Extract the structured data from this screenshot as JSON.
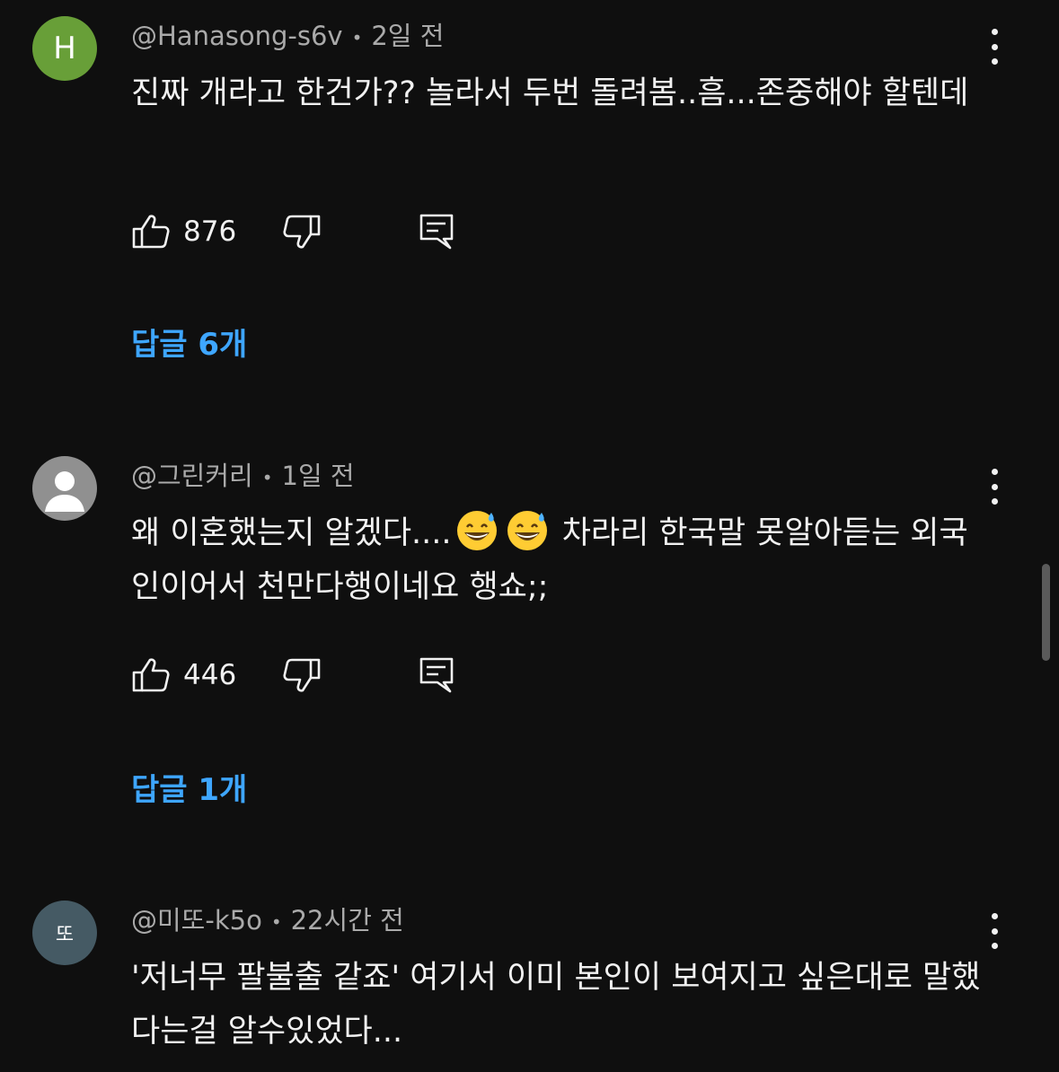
{
  "comments": [
    {
      "avatar_letter": "H",
      "avatar_color": "#689f38",
      "author": "@Hanasong-s6v",
      "time": "2일 전",
      "text": "진짜 개라고 한건가?? 놀라서 두번 돌려봄..흠...존중해야 할텐데",
      "likes": "876",
      "replies_label": "답글 6개",
      "icons": {
        "like": "thumbs-up-icon",
        "dislike": "thumbs-down-icon",
        "reply": "reply-icon",
        "more": "more-vert-icon"
      }
    },
    {
      "avatar_color": "#909090",
      "author": "@그린커리",
      "time": "1일 전",
      "text_before": "왜 이혼했는지 알겠다....",
      "text_after": " 차라리 한국말 못알아듣는 외국인이어서 천만다행이네요 행쇼;;",
      "emoji": "grinning-sweat-emoji",
      "likes": "446",
      "replies_label": "답글 1개",
      "icons": {
        "like": "thumbs-up-icon",
        "dislike": "thumbs-down-icon",
        "reply": "reply-icon",
        "more": "more-vert-icon"
      }
    },
    {
      "avatar_letter": "또",
      "avatar_color": "#455a64",
      "author": "@미또-k5o",
      "time": "22시간 전",
      "text": "'저너무 팔불출 같죠' 여기서 이미 본인이 보여지고 싶은대로 말했다는걸 알수있었다...",
      "icons": {
        "more": "more-vert-icon"
      }
    }
  ],
  "colors": {
    "background": "#0f0f0f",
    "text": "#f1f1f1",
    "meta": "#aaaaaa",
    "link": "#3ea6ff"
  }
}
